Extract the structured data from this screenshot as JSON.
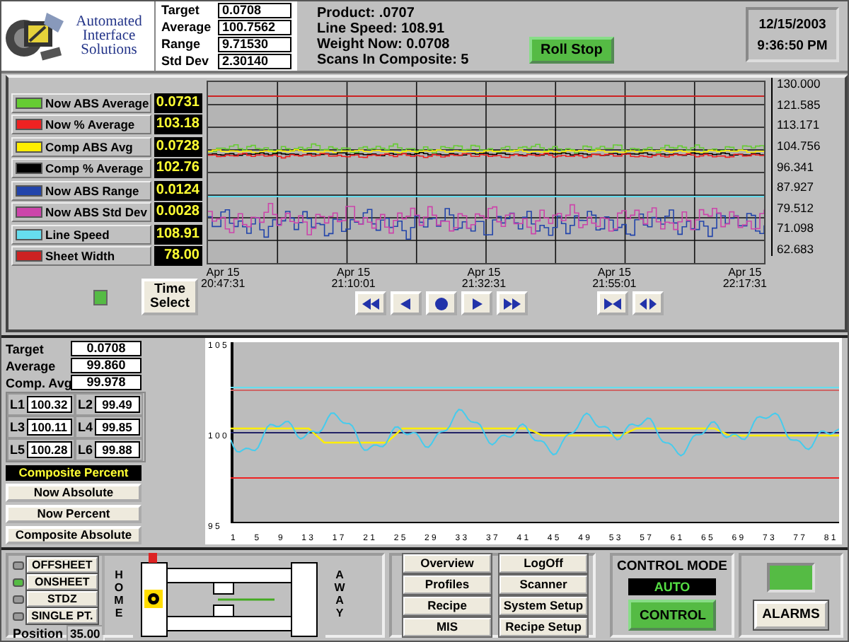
{
  "header": {
    "logo_text": "Automated Interface Solutions",
    "stats": [
      {
        "label": "Target",
        "value": "0.0708"
      },
      {
        "label": "Average",
        "value": "100.7562"
      },
      {
        "label": "Range",
        "value": "9.71530"
      },
      {
        "label": "Std Dev",
        "value": "2.30140"
      }
    ],
    "info": [
      "Product: .0707",
      "Line Speed: 108.91",
      "Weight Now: 0.0708",
      "Scans In Composite: 5"
    ],
    "roll_stop_button": "Roll Stop",
    "date": "12/15/2003",
    "time": "9:36:50 PM"
  },
  "trend": {
    "legend": [
      {
        "name": "Now ABS Average",
        "color": "#66cc33",
        "value": "0.0731"
      },
      {
        "name": "Now % Average",
        "color": "#ee2222",
        "value": "103.18"
      },
      {
        "name": "Comp ABS Avg",
        "color": "#ffee00",
        "value": "0.0728"
      },
      {
        "name": "Comp % Average",
        "color": "#000000",
        "value": "102.76"
      },
      {
        "name": "Now ABS Range",
        "color": "#2244aa",
        "value": "0.0124"
      },
      {
        "name": "Now ABS Std Dev",
        "color": "#cc44aa",
        "value": "0.0028"
      },
      {
        "name": "Line Speed",
        "color": "#66ddee",
        "value": "108.91"
      },
      {
        "name": "Sheet Width",
        "color": "#cc2222",
        "value": "78.00"
      }
    ],
    "time_select_button": "Time Select",
    "y_ticks": [
      "130.000",
      "121.585",
      "113.171",
      "104.756",
      "96.341",
      "87.927",
      "79.512",
      "71.098",
      "62.683"
    ],
    "x_labels": [
      {
        "date": "Apr 15",
        "time": "20:47:31"
      },
      {
        "date": "Apr 15",
        "time": "21:10:01"
      },
      {
        "date": "Apr 15",
        "time": "21:32:31"
      },
      {
        "date": "Apr 15",
        "time": "21:55:01"
      },
      {
        "date": "Apr 15",
        "time": "22:17:31"
      }
    ]
  },
  "profile": {
    "stats": [
      {
        "label": "Target",
        "value": "0.0708"
      },
      {
        "label": "Average",
        "value": "99.860"
      },
      {
        "label": "Comp. Avg",
        "value": "99.978"
      }
    ],
    "lanes": [
      {
        "label": "L1",
        "value": "100.32"
      },
      {
        "label": "L2",
        "value": "99.49"
      },
      {
        "label": "L3",
        "value": "100.11"
      },
      {
        "label": "L4",
        "value": "99.85"
      },
      {
        "label": "L5",
        "value": "100.28"
      },
      {
        "label": "L6",
        "value": "99.88"
      }
    ],
    "view_buttons": [
      {
        "label": "Composite Percent",
        "selected": true
      },
      {
        "label": "Now Absolute",
        "selected": false
      },
      {
        "label": "Now Percent",
        "selected": false
      },
      {
        "label": "Composite Absolute",
        "selected": false
      }
    ],
    "y_ticks": [
      "1 0 5",
      "1 0 0",
      "9 5"
    ],
    "x_ticks": [
      "1",
      "5",
      "9",
      "1 3",
      "1 7",
      "2 1",
      "2 5",
      "2 9",
      "3 3",
      "3 7",
      "4 1",
      "4 5",
      "4 9",
      "5 3",
      "5 7",
      "6 1",
      "6 5",
      "6 9",
      "7 3",
      "7 7",
      "8 1"
    ]
  },
  "bottom": {
    "sheet_buttons": [
      {
        "label": "OFFSHEET",
        "selected": false
      },
      {
        "label": "ONSHEET",
        "selected": true
      },
      {
        "label": "STDZ",
        "selected": false
      },
      {
        "label": "SINGLE PT.",
        "selected": false
      }
    ],
    "position_label": "Position",
    "position_value": "35.00",
    "home_label": "HOME",
    "away_label": "AWAY",
    "nav_buttons": [
      "Overview",
      "LogOff",
      "Profiles",
      "Scanner",
      "Recipe",
      "System Setup",
      "MIS",
      "Recipe Setup"
    ],
    "control_mode_title": "CONTROL MODE",
    "control_mode_value": "AUTO",
    "control_button": "CONTROL",
    "alarms_button": "ALARMS"
  }
}
